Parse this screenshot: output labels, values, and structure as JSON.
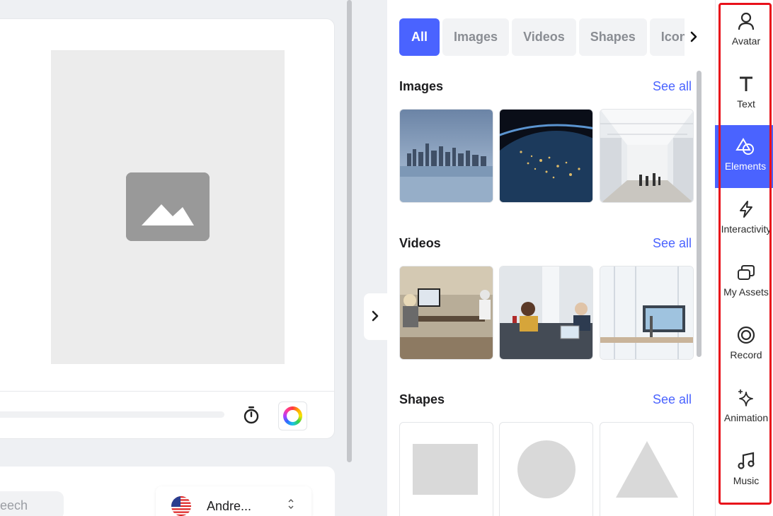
{
  "editor": {
    "speech_placeholder": "peech",
    "voice_name": "Andre...",
    "voice_caret": "⌃⌄"
  },
  "panel": {
    "filters": [
      "All",
      "Images",
      "Videos",
      "Shapes",
      "Icons"
    ],
    "active_filter": "All",
    "sections": {
      "images": {
        "title": "Images",
        "see_all": "See all"
      },
      "videos": {
        "title": "Videos",
        "see_all": "See all"
      },
      "shapes": {
        "title": "Shapes",
        "see_all": "See all"
      }
    }
  },
  "toolbar": {
    "items": [
      {
        "label": "Avatar",
        "icon": "person-icon"
      },
      {
        "label": "Text",
        "icon": "text-icon"
      },
      {
        "label": "Elements",
        "icon": "shapes-icon",
        "active": true
      },
      {
        "label": "Interactivity",
        "icon": "lightning-icon"
      },
      {
        "label": "My Assets",
        "icon": "assets-icon"
      },
      {
        "label": "Record",
        "icon": "record-icon"
      },
      {
        "label": "Animation",
        "icon": "sparkle-icon"
      },
      {
        "label": "Music",
        "icon": "music-icon"
      }
    ]
  },
  "colors": {
    "accent": "#4a63ff",
    "highlight": "#e8101a"
  }
}
